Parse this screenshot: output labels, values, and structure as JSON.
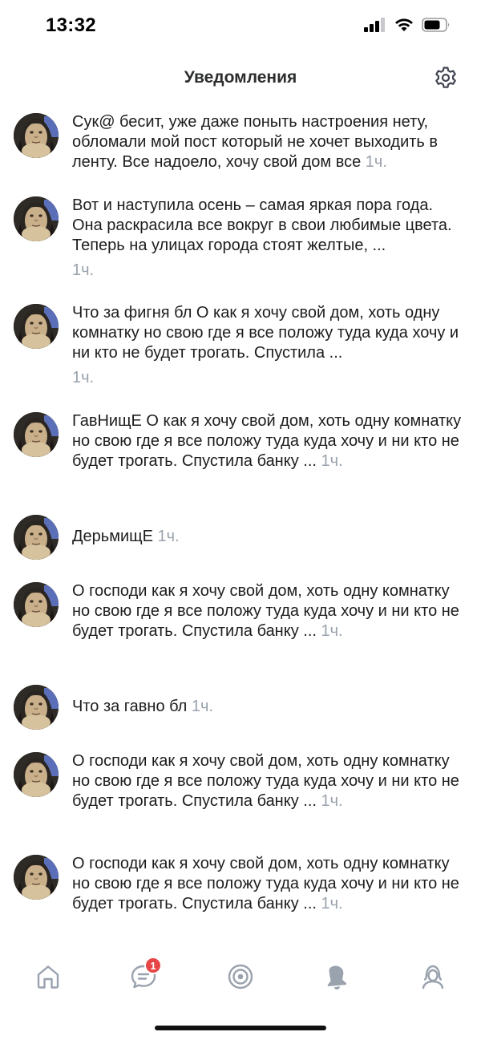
{
  "status_bar": {
    "time": "13:32",
    "icons": [
      "signal-icon",
      "wifi-icon",
      "battery-icon"
    ]
  },
  "header": {
    "title": "Уведомления",
    "settings_icon": "gear-icon"
  },
  "notifications": [
    {
      "text": "Сук@ бесит, уже даже поныть настроения нету, обломали мой пост который не хочет выходить в ленту. Все надоело, хочу свой дом все",
      "time": "1ч."
    },
    {
      "text": "Вот и наступила осень – самая яркая пора года. Она раскрасила все вокруг в свои любимые цвета. Теперь на улицах города стоят желтые, ...",
      "time": "1ч."
    },
    {
      "text": "Что за фигня бл  О как я хочу свой дом, хоть одну комнатку но свою где я все положу туда куда хочу и ни кто не будет трогать.  Спустила ...",
      "time": "1ч."
    },
    {
      "text": "ГавНищЕ  О как я хочу свой дом, хоть одну комнатку но свою где я все положу туда куда хочу и ни кто не будет трогать.  Спустила банку ...",
      "time": "1ч."
    },
    {
      "text": "ДерьмищЕ",
      "time": "1ч."
    },
    {
      "text": "О господи как я хочу свой дом, хоть одну комнатку но свою где я все положу туда куда хочу и ни кто не будет трогать.  Спустила банку ...",
      "time": "1ч."
    },
    {
      "text": "Что за гавно бл",
      "time": "1ч."
    },
    {
      "text": "О господи как я хочу свой дом, хоть одну комнатку но свою где я все положу туда куда хочу и ни кто не будет трогать.  Спустила банку ...",
      "time": "1ч."
    },
    {
      "text": "О господи как я хочу свой дом, хоть одну комнатку но свою где я все положу туда куда хочу и ни кто не будет трогать.  Спустила банку ...",
      "time": "1ч."
    }
  ],
  "tab_bar": {
    "tabs": [
      {
        "name": "home-icon",
        "active": false
      },
      {
        "name": "messages-icon",
        "active": false,
        "badge": "1"
      },
      {
        "name": "discover-icon",
        "active": false
      },
      {
        "name": "bell-icon",
        "active": true
      },
      {
        "name": "profile-icon",
        "active": false
      }
    ]
  },
  "colors": {
    "accent": "#2d81e0",
    "icon_gray": "#99a2ad",
    "badge_red": "#e64646",
    "text": "#1d1d1f"
  }
}
